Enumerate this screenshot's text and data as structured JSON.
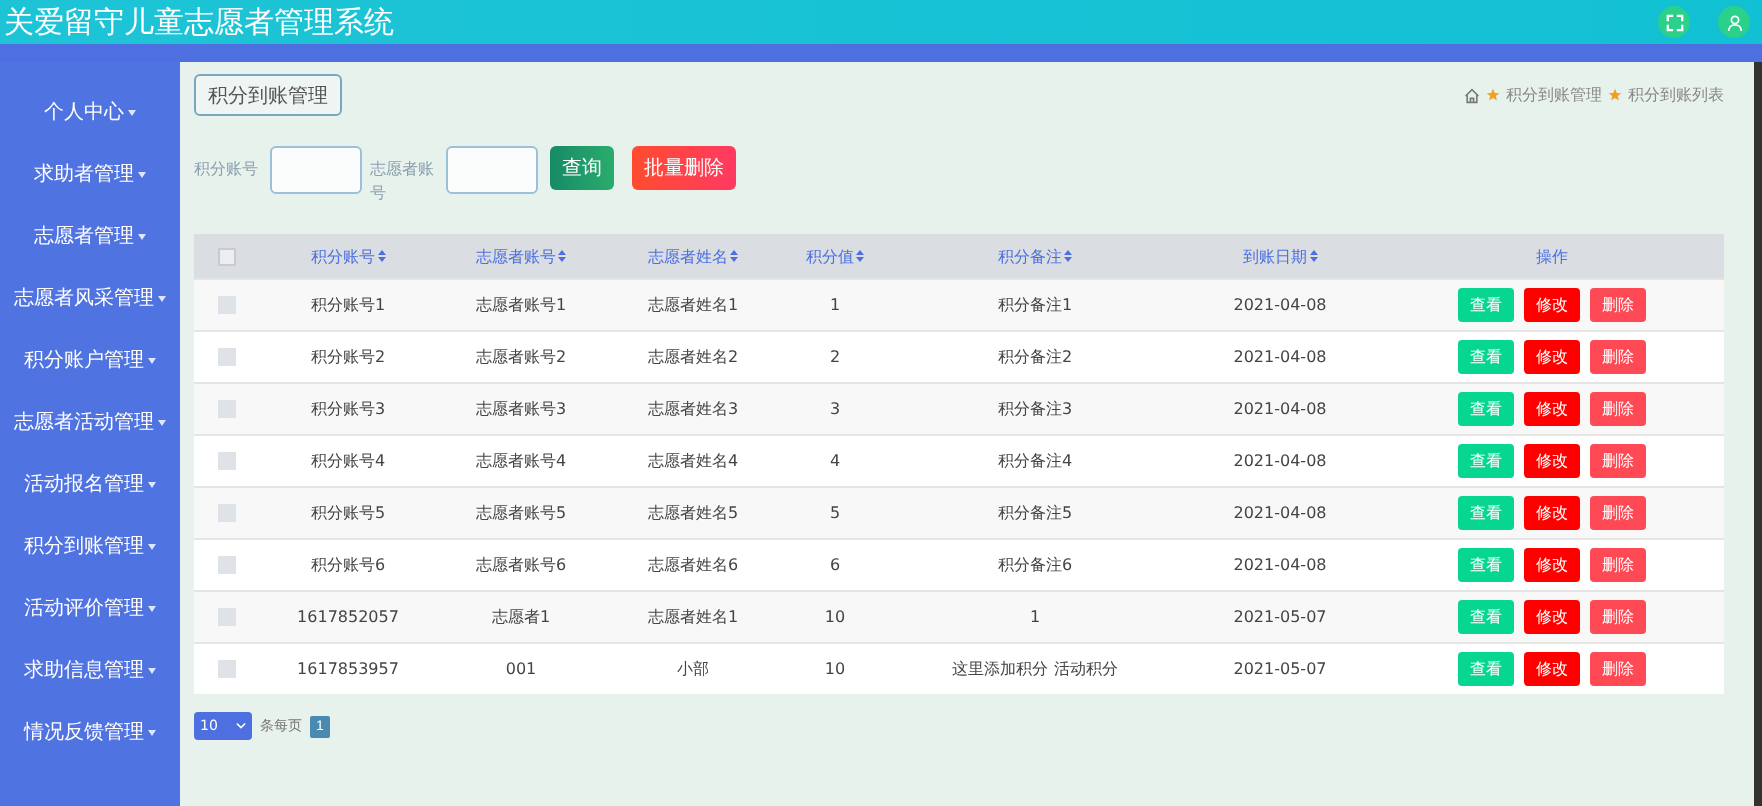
{
  "header": {
    "title": "关爱留守儿童志愿者管理系统"
  },
  "sidebar": {
    "items": [
      {
        "label": "个人中心",
        "expanded": false
      },
      {
        "label": "求助者管理",
        "expanded": false
      },
      {
        "label": "志愿者管理",
        "expanded": false
      },
      {
        "label": "志愿者风采管理",
        "expanded": false
      },
      {
        "label": "积分账户管理",
        "expanded": false
      },
      {
        "label": "志愿者活动管理",
        "expanded": false
      },
      {
        "label": "活动报名管理",
        "expanded": false
      },
      {
        "label": "积分到账管理",
        "expanded": false
      },
      {
        "label": "活动评价管理",
        "expanded": false
      },
      {
        "label": "求助信息管理",
        "expanded": false
      },
      {
        "label": "情况反馈管理",
        "expanded": false
      }
    ]
  },
  "page_title": "积分到账管理",
  "breadcrumb": [
    "积分到账管理",
    "积分到账列表"
  ],
  "filters": [
    {
      "label": "积分账号"
    },
    {
      "label": "志愿者账号"
    }
  ],
  "search_button": "查询",
  "batch_delete_button": "批量删除",
  "table": {
    "columns": [
      "积分账号",
      "志愿者账号",
      "志愿者姓名",
      "积分值",
      "积分备注",
      "到账日期"
    ],
    "actions_column": "操作",
    "select_all_checked": false,
    "rows": [
      {
        "checked": false,
        "cells": [
          "积分账号1",
          "志愿者账号1",
          "志愿者姓名1",
          "1",
          "积分备注1",
          "2021-04-08"
        ],
        "actions": [
          "查看",
          "修改",
          "删除"
        ]
      },
      {
        "checked": false,
        "cells": [
          "积分账号2",
          "志愿者账号2",
          "志愿者姓名2",
          "2",
          "积分备注2",
          "2021-04-08"
        ],
        "actions": [
          "查看",
          "修改",
          "删除"
        ]
      },
      {
        "checked": false,
        "cells": [
          "积分账号3",
          "志愿者账号3",
          "志愿者姓名3",
          "3",
          "积分备注3",
          "2021-04-08"
        ],
        "actions": [
          "查看",
          "修改",
          "删除"
        ]
      },
      {
        "checked": false,
        "cells": [
          "积分账号4",
          "志愿者账号4",
          "志愿者姓名4",
          "4",
          "积分备注4",
          "2021-04-08"
        ],
        "actions": [
          "查看",
          "修改",
          "删除"
        ]
      },
      {
        "checked": false,
        "cells": [
          "积分账号5",
          "志愿者账号5",
          "志愿者姓名5",
          "5",
          "积分备注5",
          "2021-04-08"
        ],
        "actions": [
          "查看",
          "修改",
          "删除"
        ]
      },
      {
        "checked": false,
        "cells": [
          "积分账号6",
          "志愿者账号6",
          "志愿者姓名6",
          "6",
          "积分备注6",
          "2021-04-08"
        ],
        "actions": [
          "查看",
          "修改",
          "删除"
        ]
      },
      {
        "checked": false,
        "cells": [
          "1617852057",
          "志愿者1",
          "志愿者姓名1",
          "10",
          "1",
          "2021-05-07"
        ],
        "actions": [
          "查看",
          "修改",
          "删除"
        ]
      },
      {
        "checked": false,
        "cells": [
          "1617853957",
          "001",
          "小部",
          "10",
          "这里添加积分 活动积分",
          "2021-05-07"
        ],
        "actions": [
          "查看",
          "修改",
          "删除"
        ]
      }
    ]
  },
  "pagination": {
    "page_size": "10",
    "page_size_label": "条每页",
    "pages": [
      {
        "label": "1",
        "selected": true
      }
    ]
  }
}
